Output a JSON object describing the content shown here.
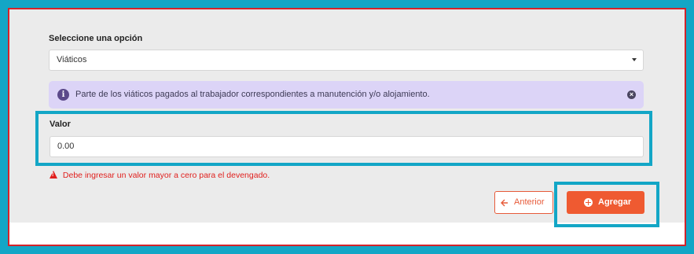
{
  "form": {
    "select_label": "Seleccione una opción",
    "select_value": "Viáticos",
    "info_text": "Parte de los viáticos pagados al trabajador correspondientes a manutención y/o alojamiento.",
    "valor_label": "Valor",
    "valor_value": "0.00",
    "error_text": "Debe ingresar un valor mayor a cero para el devengado."
  },
  "buttons": {
    "anterior_label": "Anterior",
    "agregar_label": "Agregar"
  },
  "icons": {
    "info": "info-icon",
    "close": "close-icon",
    "caret": "caret-down-icon",
    "warning": "warning-icon",
    "arrow_left": "arrow-left-icon",
    "plus": "plus-circle-icon"
  },
  "colors": {
    "highlight": "#13a6c6",
    "border_red": "#d3232a",
    "accent_orange": "#ef5a31",
    "error_red": "#e0201e",
    "info_bg": "#dcd4f7"
  }
}
